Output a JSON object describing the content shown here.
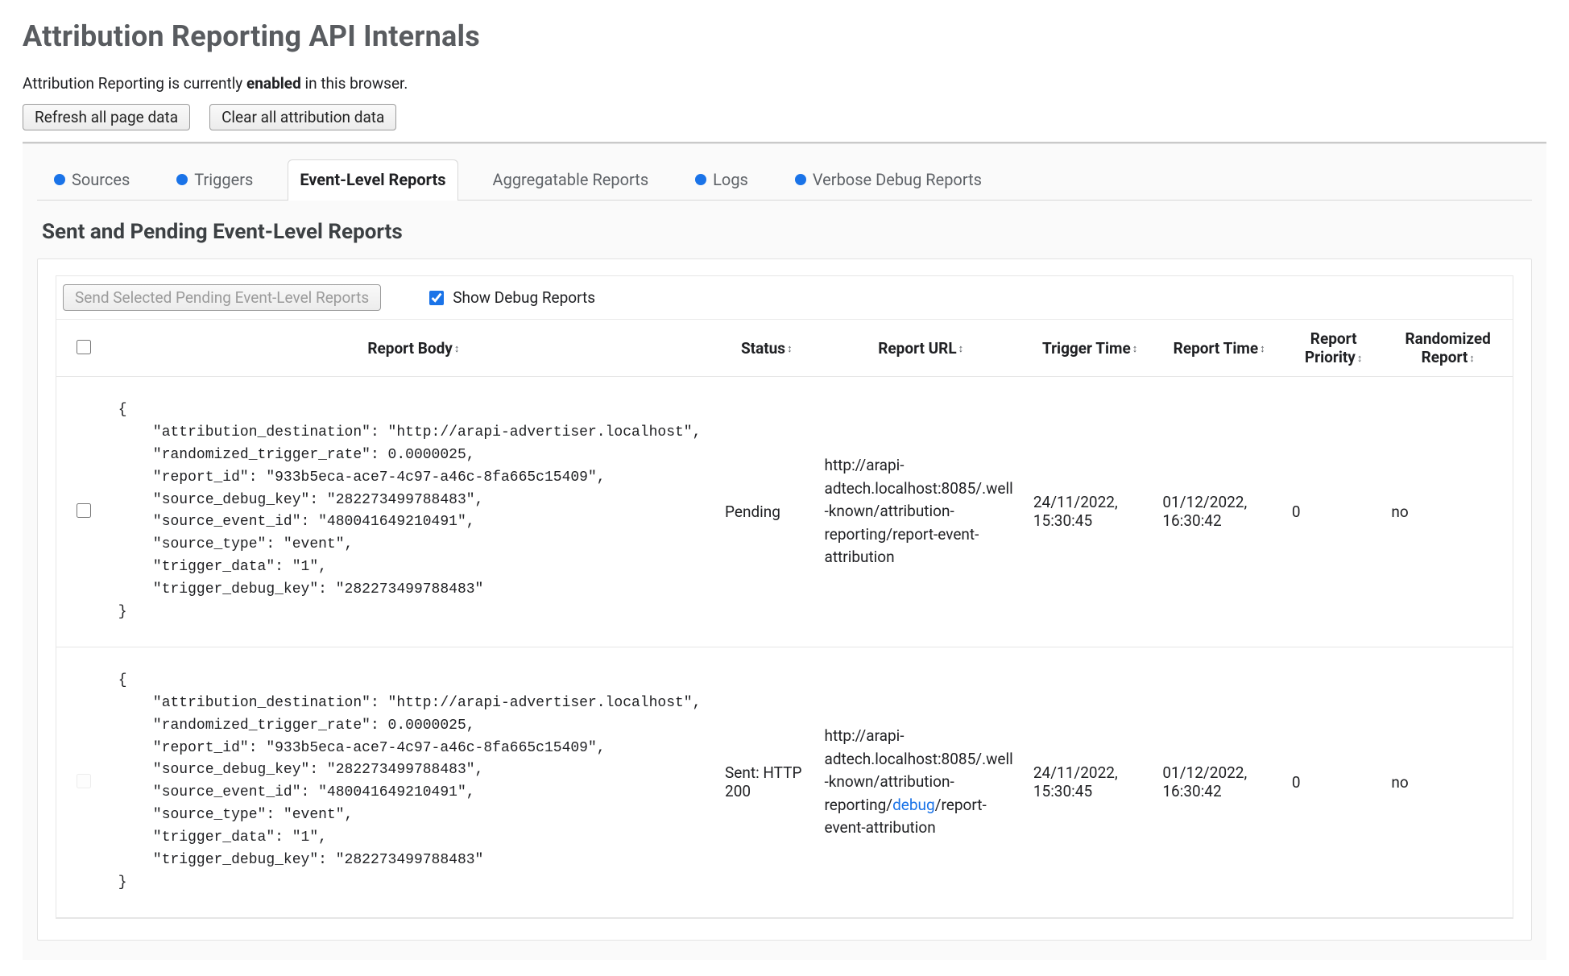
{
  "header": {
    "title": "Attribution Reporting API Internals",
    "status_prefix": "Attribution Reporting is currently ",
    "status_bold": "enabled",
    "status_suffix": " in this browser.",
    "buttons": {
      "refresh": "Refresh all page data",
      "clear_all": "Clear all attribution data"
    }
  },
  "tabs": [
    {
      "label": "Sources",
      "dot": true,
      "active": false
    },
    {
      "label": "Triggers",
      "dot": true,
      "active": false
    },
    {
      "label": "Event-Level Reports",
      "dot": false,
      "active": true
    },
    {
      "label": "Aggregatable Reports",
      "dot": false,
      "active": false
    },
    {
      "label": "Logs",
      "dot": true,
      "active": false
    },
    {
      "label": "Verbose Debug Reports",
      "dot": true,
      "active": false
    }
  ],
  "section": {
    "title": "Sent and Pending Event-Level Reports",
    "send_button": "Send Selected Pending Event-Level Reports",
    "show_debug_label": "Show Debug Reports",
    "show_debug_checked": true
  },
  "columns": {
    "body": "Report Body",
    "status": "Status",
    "url": "Report URL",
    "trigger_time": "Trigger Time",
    "report_time": "Report Time",
    "priority": "Report Priority",
    "randomized": "Randomized Report"
  },
  "rows": [
    {
      "selectable": true,
      "body": {
        "attribution_destination": "http://arapi-advertiser.localhost",
        "randomized_trigger_rate": 2.5e-06,
        "report_id": "933b5eca-ace7-4c97-a46c-8fa665c15409",
        "source_debug_key": "282273499788483",
        "source_event_id": "480041649210491",
        "source_type": "event",
        "trigger_data": "1",
        "trigger_debug_key": "282273499788483"
      },
      "status": "Pending",
      "url_plain": "http://arapi-adtech.localhost:8085/.well-known/attribution-reporting/report-event-attribution",
      "url_parts": null,
      "trigger_time": "24/11/2022, 15:30:45",
      "report_time": "01/12/2022, 16:30:42",
      "priority": "0",
      "randomized": "no"
    },
    {
      "selectable": false,
      "body": {
        "attribution_destination": "http://arapi-advertiser.localhost",
        "randomized_trigger_rate": 2.5e-06,
        "report_id": "933b5eca-ace7-4c97-a46c-8fa665c15409",
        "source_debug_key": "282273499788483",
        "source_event_id": "480041649210491",
        "source_type": "event",
        "trigger_data": "1",
        "trigger_debug_key": "282273499788483"
      },
      "status": "Sent: HTTP 200",
      "url_plain": null,
      "url_parts": {
        "pre": "http://arapi-adtech.localhost:8085/.well-known/attribution-reporting/",
        "debug": "debug",
        "post": "/report-event-attribution"
      },
      "trigger_time": "24/11/2022, 15:30:45",
      "report_time": "01/12/2022, 16:30:42",
      "priority": "0",
      "randomized": "no"
    }
  ]
}
